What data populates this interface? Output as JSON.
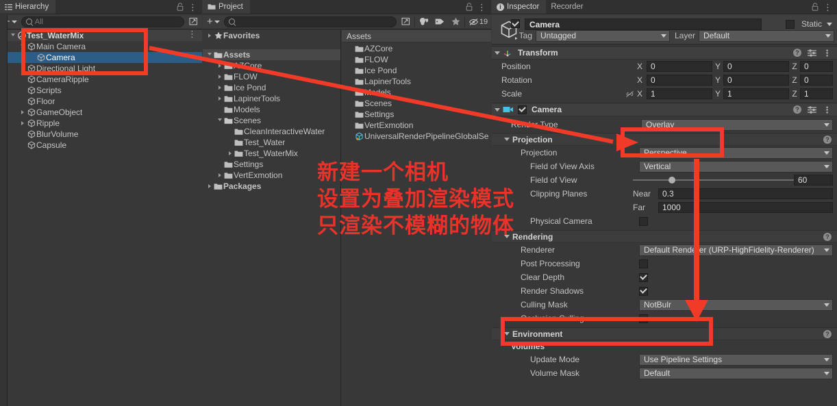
{
  "hierarchy": {
    "tab_label": "Hierarchy",
    "tab_icon": "hierarchy-icon",
    "toolbar": {
      "create_label": "+",
      "search_placeholder": "All",
      "search_value": ""
    },
    "items": [
      {
        "label": "Test_WaterMix",
        "indent": 0,
        "icon": "unity-scene-icon",
        "expander": "open",
        "kind": "scene",
        "selected": false
      },
      {
        "label": "Main Camera",
        "indent": 1,
        "icon": "gameobject-icon",
        "expander": "open",
        "kind": "object",
        "selected": false
      },
      {
        "label": "Camera",
        "indent": 2,
        "icon": "gameobject-icon",
        "expander": "none",
        "kind": "object",
        "selected": true
      },
      {
        "label": "Directional Light",
        "indent": 1,
        "icon": "gameobject-icon",
        "expander": "none",
        "kind": "object",
        "selected": false
      },
      {
        "label": "CameraRipple",
        "indent": 1,
        "icon": "gameobject-icon",
        "expander": "none",
        "kind": "object",
        "selected": false
      },
      {
        "label": "Scripts",
        "indent": 1,
        "icon": "gameobject-icon",
        "expander": "none",
        "kind": "object",
        "selected": false
      },
      {
        "label": "Floor",
        "indent": 1,
        "icon": "gameobject-icon",
        "expander": "none",
        "kind": "object",
        "selected": false
      },
      {
        "label": "GameObject",
        "indent": 1,
        "icon": "gameobject-icon",
        "expander": "closed",
        "kind": "object",
        "selected": false
      },
      {
        "label": "Ripple",
        "indent": 1,
        "icon": "gameobject-icon",
        "expander": "closed",
        "kind": "object",
        "selected": false
      },
      {
        "label": "BlurVolume",
        "indent": 1,
        "icon": "gameobject-icon",
        "expander": "none",
        "kind": "object",
        "selected": false
      },
      {
        "label": "Capsule",
        "indent": 1,
        "icon": "gameobject-icon",
        "expander": "none",
        "kind": "object",
        "selected": false
      }
    ]
  },
  "project": {
    "tab_label": "Project",
    "tab_icon": "folder-icon",
    "toolbar": {
      "create_label": "+",
      "search_placeholder": "",
      "icons": [
        "asset-type-filter-icon",
        "label-filter-icon",
        "favorite-star-icon",
        "hidden-packages-icon"
      ],
      "hidden_count": "19"
    },
    "tree": [
      {
        "label": "Favorites",
        "indent": 0,
        "icon": "star-icon",
        "expander": "closed",
        "selected": false
      },
      {
        "label": "",
        "indent": 0,
        "icon": "none",
        "expander": "none",
        "selected": false,
        "spacer": true
      },
      {
        "label": "Assets",
        "indent": 0,
        "icon": "folder-open-icon",
        "expander": "open",
        "selected": true
      },
      {
        "label": "AZCore",
        "indent": 1,
        "icon": "folder-icon",
        "expander": "closed",
        "selected": false
      },
      {
        "label": "FLOW",
        "indent": 1,
        "icon": "folder-icon",
        "expander": "closed",
        "selected": false
      },
      {
        "label": "Ice Pond",
        "indent": 1,
        "icon": "folder-icon",
        "expander": "closed",
        "selected": false
      },
      {
        "label": "LapinerTools",
        "indent": 1,
        "icon": "folder-icon",
        "expander": "closed",
        "selected": false
      },
      {
        "label": "Models",
        "indent": 1,
        "icon": "folder-icon",
        "expander": "none",
        "selected": false
      },
      {
        "label": "Scenes",
        "indent": 1,
        "icon": "folder-open-icon",
        "expander": "open",
        "selected": false
      },
      {
        "label": "CleanInteractiveWater",
        "indent": 2,
        "icon": "folder-icon",
        "expander": "none",
        "selected": false
      },
      {
        "label": "Test_Water",
        "indent": 2,
        "icon": "folder-icon",
        "expander": "none",
        "selected": false
      },
      {
        "label": "Test_WaterMix",
        "indent": 2,
        "icon": "folder-icon",
        "expander": "closed",
        "selected": false
      },
      {
        "label": "Settings",
        "indent": 1,
        "icon": "folder-icon",
        "expander": "none",
        "selected": false
      },
      {
        "label": "VertExmotion",
        "indent": 1,
        "icon": "folder-icon",
        "expander": "closed",
        "selected": false
      },
      {
        "label": "Packages",
        "indent": 0,
        "icon": "folder-icon",
        "expander": "closed",
        "selected": false
      }
    ],
    "content_header": "Assets",
    "content": [
      {
        "label": "AZCore",
        "icon": "folder-icon"
      },
      {
        "label": "FLOW",
        "icon": "folder-icon"
      },
      {
        "label": "Ice Pond",
        "icon": "folder-icon"
      },
      {
        "label": "LapinerTools",
        "icon": "folder-icon"
      },
      {
        "label": "Models",
        "icon": "folder-icon"
      },
      {
        "label": "Scenes",
        "icon": "folder-icon"
      },
      {
        "label": "Settings",
        "icon": "folder-icon"
      },
      {
        "label": "VertExmotion",
        "icon": "folder-icon"
      },
      {
        "label": "UniversalRenderPipelineGlobalSe",
        "icon": "asset-settings-icon"
      }
    ]
  },
  "inspector": {
    "tabs": [
      {
        "label": "Inspector",
        "icon": "info-icon",
        "active": true
      },
      {
        "label": "Recorder",
        "icon": "none",
        "active": false
      }
    ],
    "object": {
      "enabled": true,
      "name": "Camera",
      "static_label": "Static",
      "tag_label": "Tag",
      "tag_value": "Untagged",
      "layer_label": "Layer",
      "layer_value": "Default"
    },
    "transform": {
      "title": "Transform",
      "icon": "transform-axis-icon",
      "rows": [
        {
          "label": "Position",
          "x": "0",
          "y": "0",
          "z": "0"
        },
        {
          "label": "Rotation",
          "x": "0",
          "y": "0",
          "z": "0"
        },
        {
          "label": "Scale",
          "x": "1",
          "y": "1",
          "z": "1",
          "link_icon": "constrain-proportions-off-icon"
        }
      ],
      "axis_x": "X",
      "axis_y": "Y",
      "axis_z": "Z"
    },
    "camera": {
      "title": "Camera",
      "icon": "camera-icon",
      "enabled": true,
      "render_type_label": "Render Type",
      "render_type_value": "Overlay",
      "projection_section": "Projection",
      "projection_label": "Projection",
      "projection_value": "Perspective",
      "fov_axis_label": "Field of View Axis",
      "fov_axis_value": "Vertical",
      "fov_label": "Field of View",
      "fov_value": "60",
      "clipping_label": "Clipping Planes",
      "near_label": "Near",
      "near_value": "0.3",
      "far_label": "Far",
      "far_value": "1000",
      "physical_camera_label": "Physical Camera",
      "physical_camera_checked": false,
      "rendering_section": "Rendering",
      "renderer_label": "Renderer",
      "renderer_value": "Default Renderer (URP-HighFidelity-Renderer)",
      "post_processing_label": "Post Processing",
      "post_processing_checked": false,
      "clear_depth_label": "Clear Depth",
      "clear_depth_checked": true,
      "render_shadows_label": "Render Shadows",
      "render_shadows_checked": true,
      "culling_mask_label": "Culling Mask",
      "culling_mask_value": "NotBulr",
      "occlusion_culling_label": "Occlusion Culling",
      "occlusion_culling_checked": false,
      "environment_section": "Environment",
      "volumes_label": "Volumes",
      "update_mode_label": "Update Mode",
      "update_mode_value": "Use Pipeline Settings",
      "volume_mask_label": "Volume Mask",
      "volume_mask_value": "Default"
    }
  },
  "annotations": {
    "color": "#f23a28",
    "text_color": "#e8322a",
    "lines": [
      "新建一个相机",
      "设置为叠加渲染模式",
      "只渲染不模糊的物体"
    ],
    "highlight_hierarchy": "Test_WaterMix / Main Camera / Camera / Directional Light",
    "highlight_render_type": "Overlay",
    "highlight_culling_mask": "NotBulr"
  }
}
